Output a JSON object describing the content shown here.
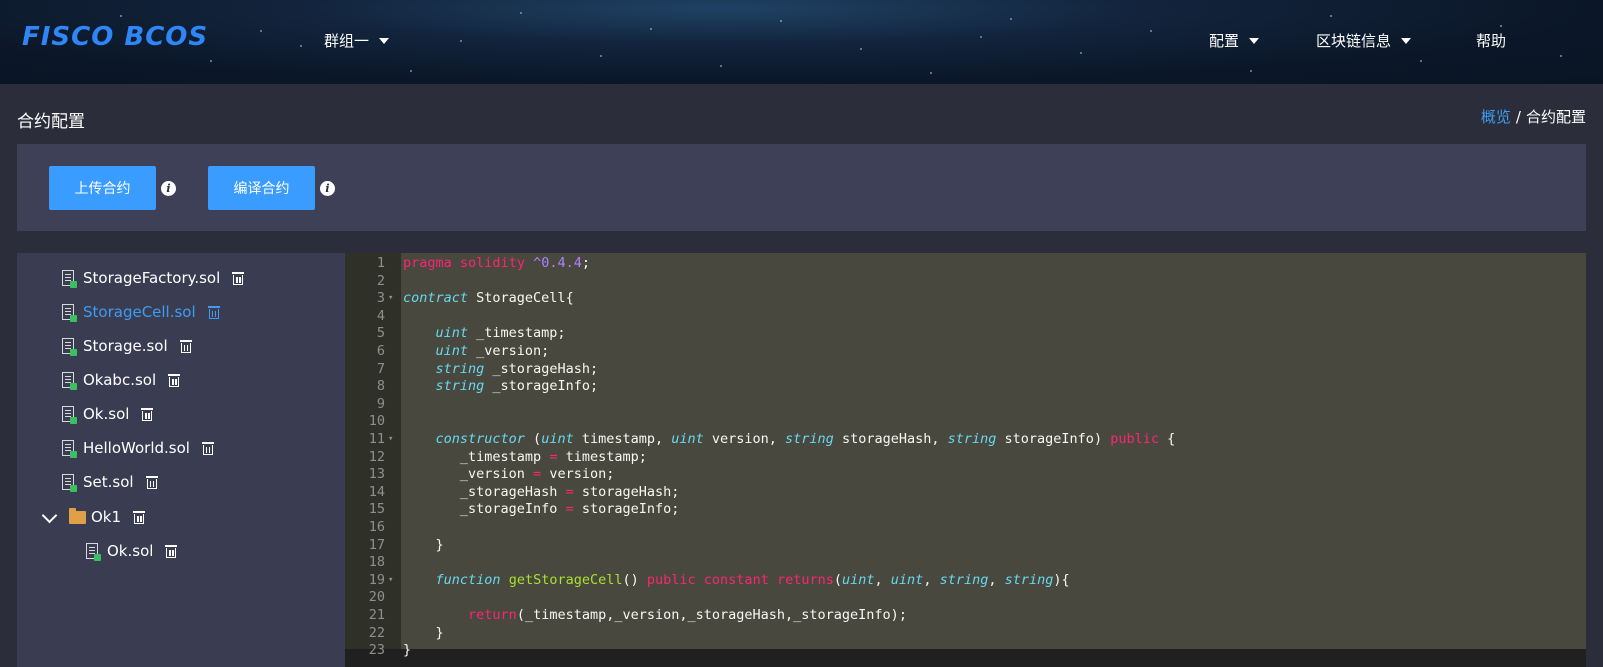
{
  "header": {
    "logo": "FISCO BCOS",
    "group_menu": "群组一",
    "nav": {
      "config": "配置",
      "chain_info": "区块链信息",
      "help": "帮助"
    }
  },
  "page": {
    "title": "合约配置",
    "breadcrumb": {
      "home": "概览",
      "separator": "/",
      "current": "合约配置"
    }
  },
  "toolbar": {
    "upload_label": "上传合约",
    "compile_label": "编译合约",
    "info_glyph": "i"
  },
  "file_tree": {
    "files": [
      {
        "name": "StorageFactory.sol",
        "active": false
      },
      {
        "name": "StorageCell.sol",
        "active": true
      },
      {
        "name": "Storage.sol",
        "active": false
      },
      {
        "name": "Okabc.sol",
        "active": false
      },
      {
        "name": "Ok.sol",
        "active": false
      },
      {
        "name": "HelloWorld.sol",
        "active": false
      },
      {
        "name": "Set.sol",
        "active": false
      }
    ],
    "folder": {
      "name": "Ok1",
      "expanded": true,
      "children": [
        {
          "name": "Ok.sol"
        }
      ]
    }
  },
  "editor": {
    "line_numbers": [
      "1",
      "2",
      "3",
      "4",
      "5",
      "6",
      "7",
      "8",
      "9",
      "10",
      "11",
      "12",
      "13",
      "14",
      "15",
      "16",
      "17",
      "18",
      "19",
      "20",
      "21",
      "22",
      "23"
    ],
    "lines": [
      "pragma solidity ^0.4.4;",
      "",
      "contract StorageCell{",
      "",
      "    uint _timestamp;",
      "    uint _version;",
      "    string _storageHash;",
      "    string _storageInfo;",
      "",
      "",
      "    constructor (uint timestamp, uint version, string storageHash, string storageInfo) public {",
      "       _timestamp = timestamp;",
      "       _version = version;",
      "       _storageHash = storageHash;",
      "       _storageInfo = storageInfo;",
      "",
      "    }",
      "",
      "    function getStorageCell() public constant returns(uint, uint, string, string){",
      "",
      "        return(_timestamp,_version,_storageHash,_storageInfo);",
      "    }",
      "}"
    ],
    "theme_colors": {
      "background": "#272822",
      "keyword": "#f92672",
      "type": "#66d9ef",
      "number": "#ae81ff",
      "function": "#a6e22e"
    }
  }
}
